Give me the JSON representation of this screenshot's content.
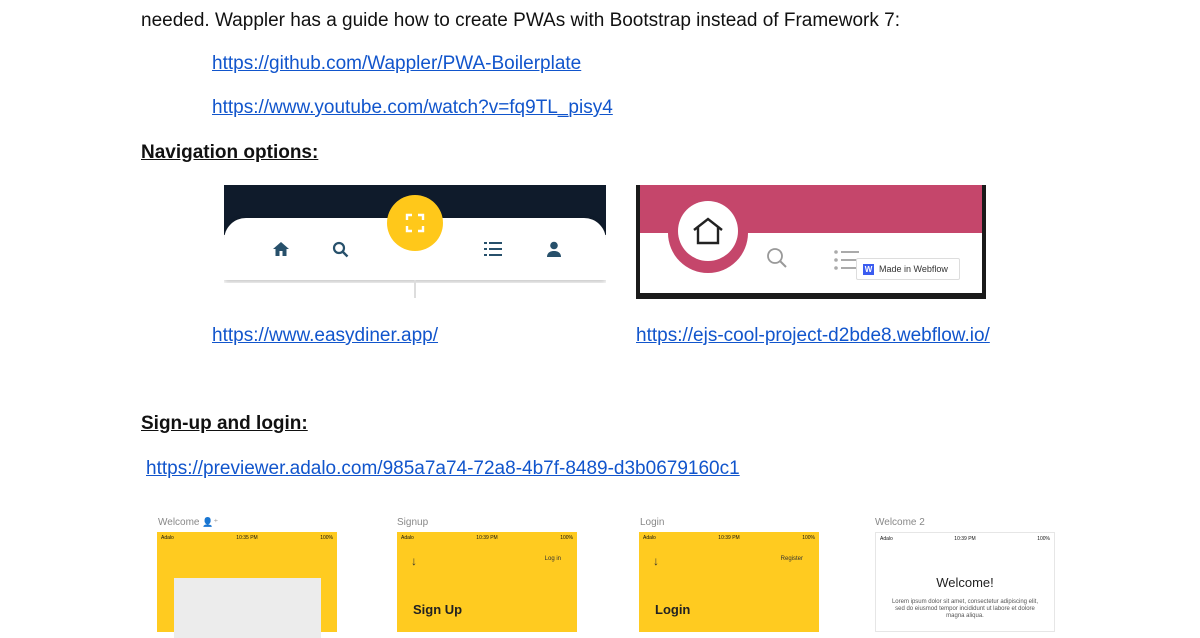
{
  "intro_line": "needed. Wappler has a guide how to create PWAs with Bootstrap instead of Framework 7:",
  "links": {
    "pwa_boilerplate": "https://github.com/Wappler/PWA-Boilerplate",
    "youtube": "https://www.youtube.com/watch?v=fq9TL_pisy4",
    "easydiner": "https://www.easydiner.app/",
    "webflow": "https://ejs-cool-project-d2bde8.webflow.io/",
    "adalo": "https://previewer.adalo.com/985a7a74-72a8-4b7f-8489-d3b0679160c1"
  },
  "headings": {
    "navigation": "Navigation options:",
    "signup": "Sign-up and login:"
  },
  "webflow_badge": "Made in Webflow",
  "icons": {
    "nav1": [
      "home-icon",
      "search-icon",
      "fullscreen-icon",
      "list-icon",
      "person-icon"
    ],
    "nav2": [
      "home-outline-icon",
      "search-icon",
      "list-icon"
    ]
  },
  "adalo_screens": [
    {
      "label": "Welcome",
      "status_left": "Adalo",
      "status_mid": "10:35 PM",
      "status_right": "100%"
    },
    {
      "label": "Signup",
      "status_left": "Adalo",
      "status_mid": "10:39 PM",
      "status_right": "100%",
      "top_right": "Log in",
      "title": "Sign Up"
    },
    {
      "label": "Login",
      "status_left": "Adalo",
      "status_mid": "10:39 PM",
      "status_right": "100%",
      "top_right": "Register",
      "title": "Login"
    },
    {
      "label": "Welcome 2",
      "status_left": "Adalo",
      "status_mid": "10:39 PM",
      "status_right": "100%",
      "title": "Welcome!",
      "body": "Lorem ipsum dolor sit amet, consectetur adipiscing elit, sed do eiusmod tempor incididunt ut labore et dolore magna aliqua."
    }
  ],
  "colors": {
    "link": "#1155cc",
    "accent_yellow": "#ffcb20",
    "webflow_pink": "#c5466b",
    "nav_dark": "#0f1b2b"
  }
}
